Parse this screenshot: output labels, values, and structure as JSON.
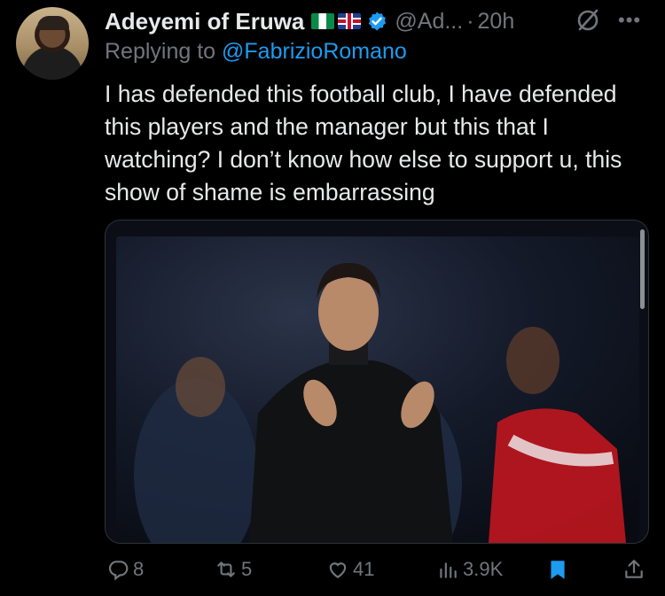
{
  "tweet": {
    "display_name": "Adeyemi of Eruwa",
    "handle": "@Ad...",
    "separator": "·",
    "time": "20h",
    "reply_prefix": "Replying to ",
    "reply_to": "@FabrizioRomano",
    "text": "I has defended this football club, I have defended this players and the manager but this that I watching? I don’t know how else to support u, this show of shame is embarrassing"
  },
  "actions": {
    "replies": "8",
    "reposts": "5",
    "likes": "41",
    "views": "3.9K"
  },
  "colors": {
    "background": "#000000",
    "text": "#e7e9ea",
    "muted": "#71767b",
    "accent": "#1d9bf0",
    "bookmark": "#1d9bf0"
  },
  "icons": [
    "verified-badge-icon",
    "grok-icon",
    "more-icon",
    "reply-icon",
    "repost-icon",
    "like-icon",
    "views-icon",
    "bookmark-icon",
    "share-icon"
  ]
}
